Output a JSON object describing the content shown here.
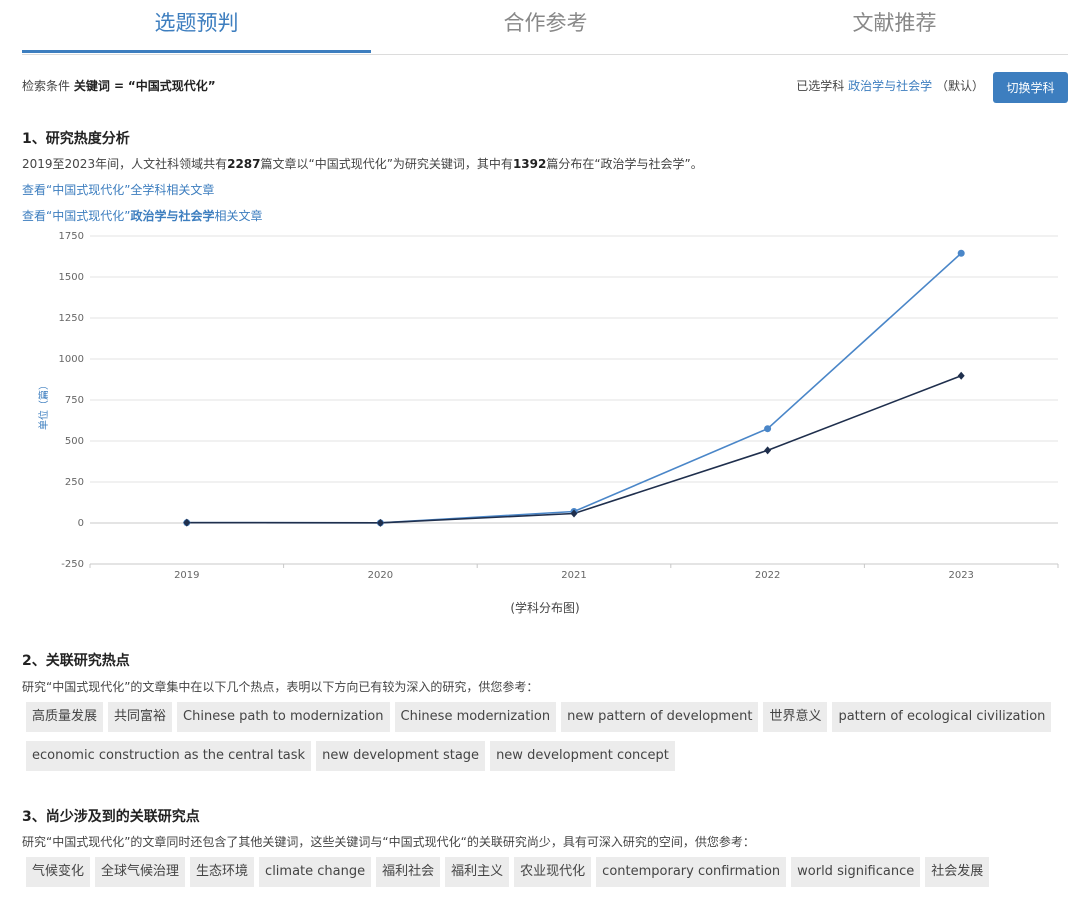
{
  "tabs": [
    {
      "label": "选题预判",
      "active": true
    },
    {
      "label": "合作参考",
      "active": false
    },
    {
      "label": "文献推荐",
      "active": false
    }
  ],
  "criteria": {
    "prefix": "检索条件",
    "key_label": "关键词 =",
    "keyword": "“中国式现代化”"
  },
  "subject": {
    "prefix": "已选学科",
    "name": "政治学与社会学",
    "suffix": "（默认）",
    "button": "切换学科"
  },
  "section1": {
    "title": "1、研究热度分析",
    "p1": "2019至2023年间，人文社科领域共有",
    "total": "2287",
    "p2": "篇文章以“中国式现代化”为研究关键词，其中有",
    "subset": "1392",
    "p3": "篇分布在“政治学与社会学”。",
    "link1": "查看“中国式现代化”全学科相关文章",
    "link2_pre": "查看“中国式现代化”",
    "link2_bold": "政治学与社会学",
    "link2_post": "相关文章"
  },
  "chart_data": {
    "type": "line",
    "x": [
      "2019",
      "2020",
      "2021",
      "2022",
      "2023"
    ],
    "series": [
      {
        "values": [
          2,
          1,
          70,
          575,
          1645
        ],
        "color": "#4a86c8"
      },
      {
        "values": [
          2,
          1,
          58,
          443,
          898
        ],
        "color": "#1f2f4d"
      }
    ],
    "ylabel": "单位（篇）",
    "ylim": [
      -250,
      1750
    ],
    "yticks": [
      -250,
      0,
      250,
      500,
      750,
      1000,
      1250,
      1500,
      1750
    ],
    "caption": "(学科分布图)",
    "grid": true
  },
  "section2": {
    "title": "2、关联研究热点",
    "desc": "研究“中国式现代化”的文章集中在以下几个热点，表明以下方向已有较为深入的研究，供您参考：",
    "tags": [
      "高质量发展",
      "共同富裕",
      "Chinese path to modernization",
      "Chinese modernization",
      "new pattern of development",
      "世界意义",
      "pattern of ecological civilization",
      "economic construction as the central task",
      "new development stage",
      "new development concept"
    ]
  },
  "section3": {
    "title": "3、尚少涉及到的关联研究点",
    "desc": "研究“中国式现代化”的文章同时还包含了其他关键词，这些关键词与“中国式现代化“的关联研究尚少，具有可深入研究的空间，供您参考：",
    "tags": [
      "气候变化",
      "全球气候治理",
      "生态环境",
      "climate change",
      "福利社会",
      "福利主义",
      "农业现代化",
      "contemporary confirmation",
      "world significance",
      "社会发展"
    ]
  }
}
